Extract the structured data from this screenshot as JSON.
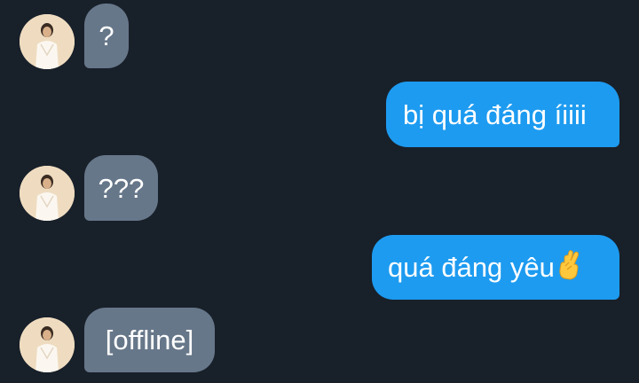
{
  "messages": [
    {
      "direction": "incoming",
      "text": "?"
    },
    {
      "direction": "outgoing",
      "text": "bị quá đáng íiiii"
    },
    {
      "direction": "incoming",
      "text": "???"
    },
    {
      "direction": "outgoing",
      "text": "quá đáng yêu",
      "emoji": "crossed-fingers-icon"
    },
    {
      "direction": "incoming",
      "text": "[offline]"
    }
  ],
  "colors": {
    "background": "#18202a",
    "incoming_bubble": "#67778a",
    "outgoing_bubble": "#1d9bf0",
    "text": "#ffffff"
  }
}
